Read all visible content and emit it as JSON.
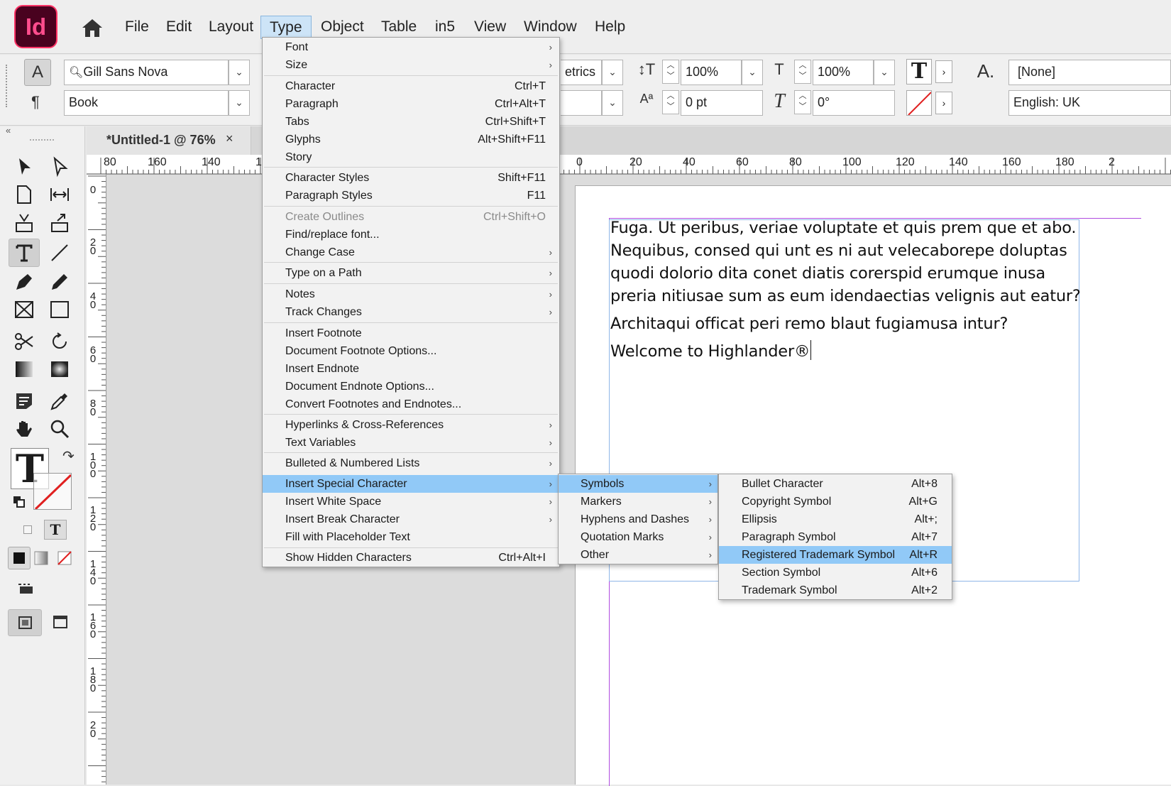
{
  "app": {
    "logo_text": "Id"
  },
  "menubar": {
    "items": [
      "File",
      "Edit",
      "Layout",
      "Type",
      "Object",
      "Table",
      "in5",
      "View",
      "Window",
      "Help"
    ],
    "active": "Type"
  },
  "control": {
    "font_family": "Gill Sans Nova",
    "font_style": "Book",
    "kerning": "etrics",
    "vscale": "100%",
    "hscale": "100%",
    "baseline": "0 pt",
    "skew": "0°",
    "char_style": "[None]",
    "language": "English: UK"
  },
  "document": {
    "tab_title": "*Untitled-1 @ 76%",
    "tab_close": "×",
    "hruler_left": [
      "80",
      "160",
      "140",
      "1"
    ],
    "hruler_right": [
      "0",
      "20",
      "40",
      "60",
      "80",
      "100",
      "120",
      "140",
      "160",
      "180",
      "2"
    ],
    "vruler": [
      "0",
      "20",
      "40",
      "60",
      "80",
      "100",
      "120",
      "140",
      "160",
      "180",
      "20"
    ],
    "paragraphs": [
      "Fuga. Ut peribus, veriae voluptate et quis prem que et abo. Nequibus, consed qui unt es ni aut velecaborepe doluptas quodi dolorio dita conet diatis corerspid erumque inusa preria nitiusae sum as eum idendaectias velignis aut eatur?",
      "Architaqui officat peri remo blaut fugiamusa intur?",
      "Welcome to Highlander®"
    ]
  },
  "type_menu": {
    "items": [
      {
        "label": "Font",
        "shortcut": "",
        "sub": true
      },
      {
        "label": "Size",
        "shortcut": "",
        "sub": true
      },
      {
        "label": "Character",
        "shortcut": "Ctrl+T"
      },
      {
        "label": "Paragraph",
        "shortcut": "Ctrl+Alt+T"
      },
      {
        "label": "Tabs",
        "shortcut": "Ctrl+Shift+T"
      },
      {
        "label": "Glyphs",
        "shortcut": "Alt+Shift+F11"
      },
      {
        "label": "Story",
        "shortcut": ""
      },
      {
        "label": "Character Styles",
        "shortcut": "Shift+F11"
      },
      {
        "label": "Paragraph Styles",
        "shortcut": "F11"
      },
      {
        "label": "Create Outlines",
        "shortcut": "Ctrl+Shift+O",
        "disabled": true
      },
      {
        "label": "Find/replace font...",
        "shortcut": ""
      },
      {
        "label": "Change Case",
        "shortcut": "",
        "sub": true
      },
      {
        "label": "Type on a Path",
        "shortcut": "",
        "sub": true
      },
      {
        "label": "Notes",
        "shortcut": "",
        "sub": true
      },
      {
        "label": "Track Changes",
        "shortcut": "",
        "sub": true
      },
      {
        "label": "Insert Footnote",
        "shortcut": ""
      },
      {
        "label": "Document Footnote Options...",
        "shortcut": ""
      },
      {
        "label": "Insert Endnote",
        "shortcut": ""
      },
      {
        "label": "Document Endnote Options...",
        "shortcut": ""
      },
      {
        "label": "Convert Footnotes and Endnotes...",
        "shortcut": ""
      },
      {
        "label": "Hyperlinks & Cross-References",
        "shortcut": "",
        "sub": true
      },
      {
        "label": "Text Variables",
        "shortcut": "",
        "sub": true
      },
      {
        "label": "Bulleted & Numbered Lists",
        "shortcut": "",
        "sub": true
      },
      {
        "label": "Insert Special Character",
        "shortcut": "",
        "sub": true,
        "highlighted": true
      },
      {
        "label": "Insert White Space",
        "shortcut": "",
        "sub": true
      },
      {
        "label": "Insert Break Character",
        "shortcut": "",
        "sub": true
      },
      {
        "label": "Fill with Placeholder Text",
        "shortcut": ""
      },
      {
        "label": "Show Hidden Characters",
        "shortcut": "Ctrl+Alt+I"
      }
    ]
  },
  "special_menu": {
    "items": [
      {
        "label": "Symbols",
        "highlighted": true
      },
      {
        "label": "Markers"
      },
      {
        "label": "Hyphens and Dashes"
      },
      {
        "label": "Quotation Marks"
      },
      {
        "label": "Other"
      }
    ]
  },
  "symbols_menu": {
    "items": [
      {
        "label": "Bullet Character",
        "shortcut": "Alt+8"
      },
      {
        "label": "Copyright Symbol",
        "shortcut": "Alt+G"
      },
      {
        "label": "Ellipsis",
        "shortcut": "Alt+;"
      },
      {
        "label": "Paragraph Symbol",
        "shortcut": "Alt+7"
      },
      {
        "label": "Registered Trademark Symbol",
        "shortcut": "Alt+R",
        "highlighted": true
      },
      {
        "label": "Section Symbol",
        "shortcut": "Alt+6"
      },
      {
        "label": "Trademark Symbol",
        "shortcut": "Alt+2"
      }
    ]
  },
  "colors": {
    "accent_highlight": "#91c9f7",
    "logo_bg": "#49021f",
    "logo_fg": "#ff4d8d",
    "margin_guide": "#b04be0",
    "frame_edge": "#8fb6e8"
  }
}
